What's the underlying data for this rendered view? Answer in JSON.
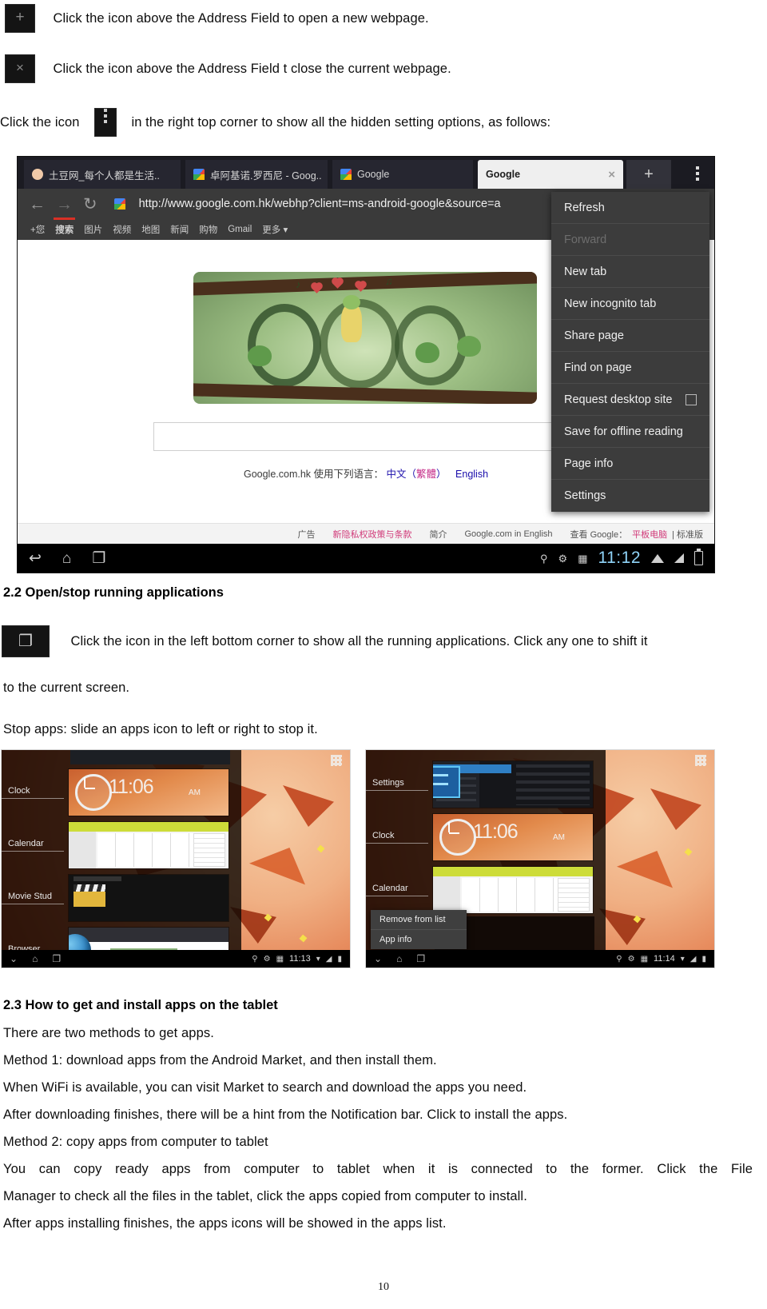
{
  "instructions": {
    "new_tab_line": "Click the icon above the Address Field to open a new webpage.",
    "close_tab_line": "Click the icon above the Address Field t close the current webpage.",
    "menu_line_before": "Click the icon",
    "menu_line_after": "in the right top corner to show all the hidden setting options, as follows:",
    "new_tab_icon_glyph": "+",
    "close_tab_icon_glyph": "×"
  },
  "browser": {
    "tabs": [
      {
        "title": "土豆网_每个人都是生活..",
        "active": false,
        "favicon": "tudou-icon"
      },
      {
        "title": "卓阿基诺.罗西尼 - Goog..",
        "active": false,
        "favicon": "google-icon"
      },
      {
        "title": "Google",
        "active": false,
        "favicon": "google-icon"
      },
      {
        "title": "Google",
        "active": true,
        "favicon": "none",
        "close_glyph": "×"
      }
    ],
    "new_tab_glyph": "+",
    "overflow_menu_name": "three-dot menu",
    "url": "http://www.google.com.hk/webhp?client=ms-android-google&source=a",
    "nav": {
      "back": "←",
      "forward": "→",
      "reload": "↻"
    },
    "google_subnav": [
      "+您",
      "搜索",
      "图片",
      "视频",
      "地图",
      "新闻",
      "购物",
      "Gmail",
      "更多 ▾"
    ],
    "language_line_prefix": "Google.com.hk 使用下列语言：",
    "language_links": [
      "中文（",
      "繁體",
      "）",
      "English"
    ],
    "page_footer_links": [
      "广告",
      "新隐私权政策与条款",
      "简介",
      "Google.com in English",
      "查看 Google：",
      "平板电脑",
      "| 标准版"
    ],
    "menu_items": [
      {
        "label": "Refresh",
        "disabled": false,
        "checkbox": false
      },
      {
        "label": "Forward",
        "disabled": true,
        "checkbox": false
      },
      {
        "label": "New tab",
        "disabled": false,
        "checkbox": false
      },
      {
        "label": "New incognito tab",
        "disabled": false,
        "checkbox": false
      },
      {
        "label": "Share page",
        "disabled": false,
        "checkbox": false
      },
      {
        "label": "Find on page",
        "disabled": false,
        "checkbox": false
      },
      {
        "label": "Request desktop site",
        "disabled": false,
        "checkbox": true
      },
      {
        "label": "Save for offline reading",
        "disabled": false,
        "checkbox": false
      },
      {
        "label": "Page info",
        "disabled": false,
        "checkbox": false
      },
      {
        "label": "Settings",
        "disabled": false,
        "checkbox": false
      }
    ],
    "system_bar": {
      "back": "↩",
      "home": "⌂",
      "recents": "❐",
      "clock": "11:12"
    }
  },
  "section22": {
    "heading": "2.2 Open/stop running applications",
    "recents_icon_glyph": "❐",
    "line1": "Click the icon in the left bottom corner to show all the running applications. Click any one to shift it",
    "line2": "to the current screen.",
    "line3": "Stop apps: slide an apps icon to left or right to stop it."
  },
  "tablet_left": {
    "recents": [
      {
        "label": "Clock",
        "thumb": "clock-thumb",
        "time": "11:06",
        "ampm": "AM"
      },
      {
        "label": "Calendar",
        "thumb": "calendar-thumb"
      },
      {
        "label": "Movie Stud",
        "thumb": "movie-studio-thumb"
      },
      {
        "label": "Browser",
        "thumb": "browser-thumb"
      }
    ],
    "system_bar": {
      "back": "⌄",
      "home": "⌂",
      "recents": "❐",
      "clock": "11:13"
    }
  },
  "tablet_right": {
    "recents": [
      {
        "label": "Settings",
        "thumb": "settings-thumb"
      },
      {
        "label": "Clock",
        "thumb": "clock-thumb",
        "time": "11:06",
        "ampm": "AM"
      },
      {
        "label": "Calendar",
        "thumb": "calendar-thumb"
      }
    ],
    "context_menu": [
      "Remove from list",
      "App info"
    ],
    "system_bar": {
      "back": "⌄",
      "home": "⌂",
      "recents": "❐",
      "clock": "11:14"
    }
  },
  "section23": {
    "heading": "2.3 How to get and install apps on the tablet",
    "lines": [
      "There are two methods to get apps.",
      "Method 1: download apps from the Android Market, and then install them.",
      "When WiFi is available, you can visit Market to search and download the apps you need.",
      "After downloading finishes, there will be a hint from the Notification bar. Click to install the apps.",
      "Method 2: copy apps from computer to tablet"
    ],
    "justified_line_1": "You can copy ready apps from computer to tablet when it is connected to the former. Click the File",
    "line_after_justified": "Manager to check all the files in the tablet, click the apps copied from computer to install.",
    "last_line": "After apps installing finishes, the apps icons will be showed in the apps list."
  },
  "page_number": "10"
}
